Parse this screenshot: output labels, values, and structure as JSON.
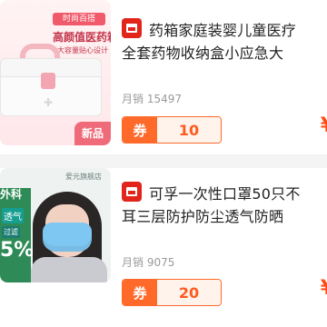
{
  "products": [
    {
      "image": {
        "tag_top": "时尚百搭",
        "headline": "高颜值医药箱",
        "subline": "大容量贴心设计",
        "badge": "新品"
      },
      "title_lines": [
        "药箱家庭装婴儿童医疗",
        "全套药物收纳盒小应急大"
      ],
      "sales": "月销 15497",
      "coupon_label": "券",
      "coupon_value": "10",
      "orig_price": "¥",
      "price": "¥"
    },
    {
      "image": {
        "brand_left": "",
        "brand_right": "爱元旗舰店",
        "text_big": "外科",
        "text_mid": "透气",
        "text_small": "过滤",
        "text_percent": "5%"
      },
      "title_lines": [
        "可孚一次性口罩50只不",
        "耳三层防护防尘透气防晒"
      ],
      "sales": "月销 9075",
      "coupon_label": "券",
      "coupon_value": "20",
      "orig_price": "¥",
      "price": "¥"
    }
  ],
  "colors": {
    "accent": "#ff5a1f",
    "brand_red": "#e1251b",
    "muted_text": "#9a9a9a"
  },
  "icons": {
    "brand_icon": "shopping-bag-icon"
  }
}
